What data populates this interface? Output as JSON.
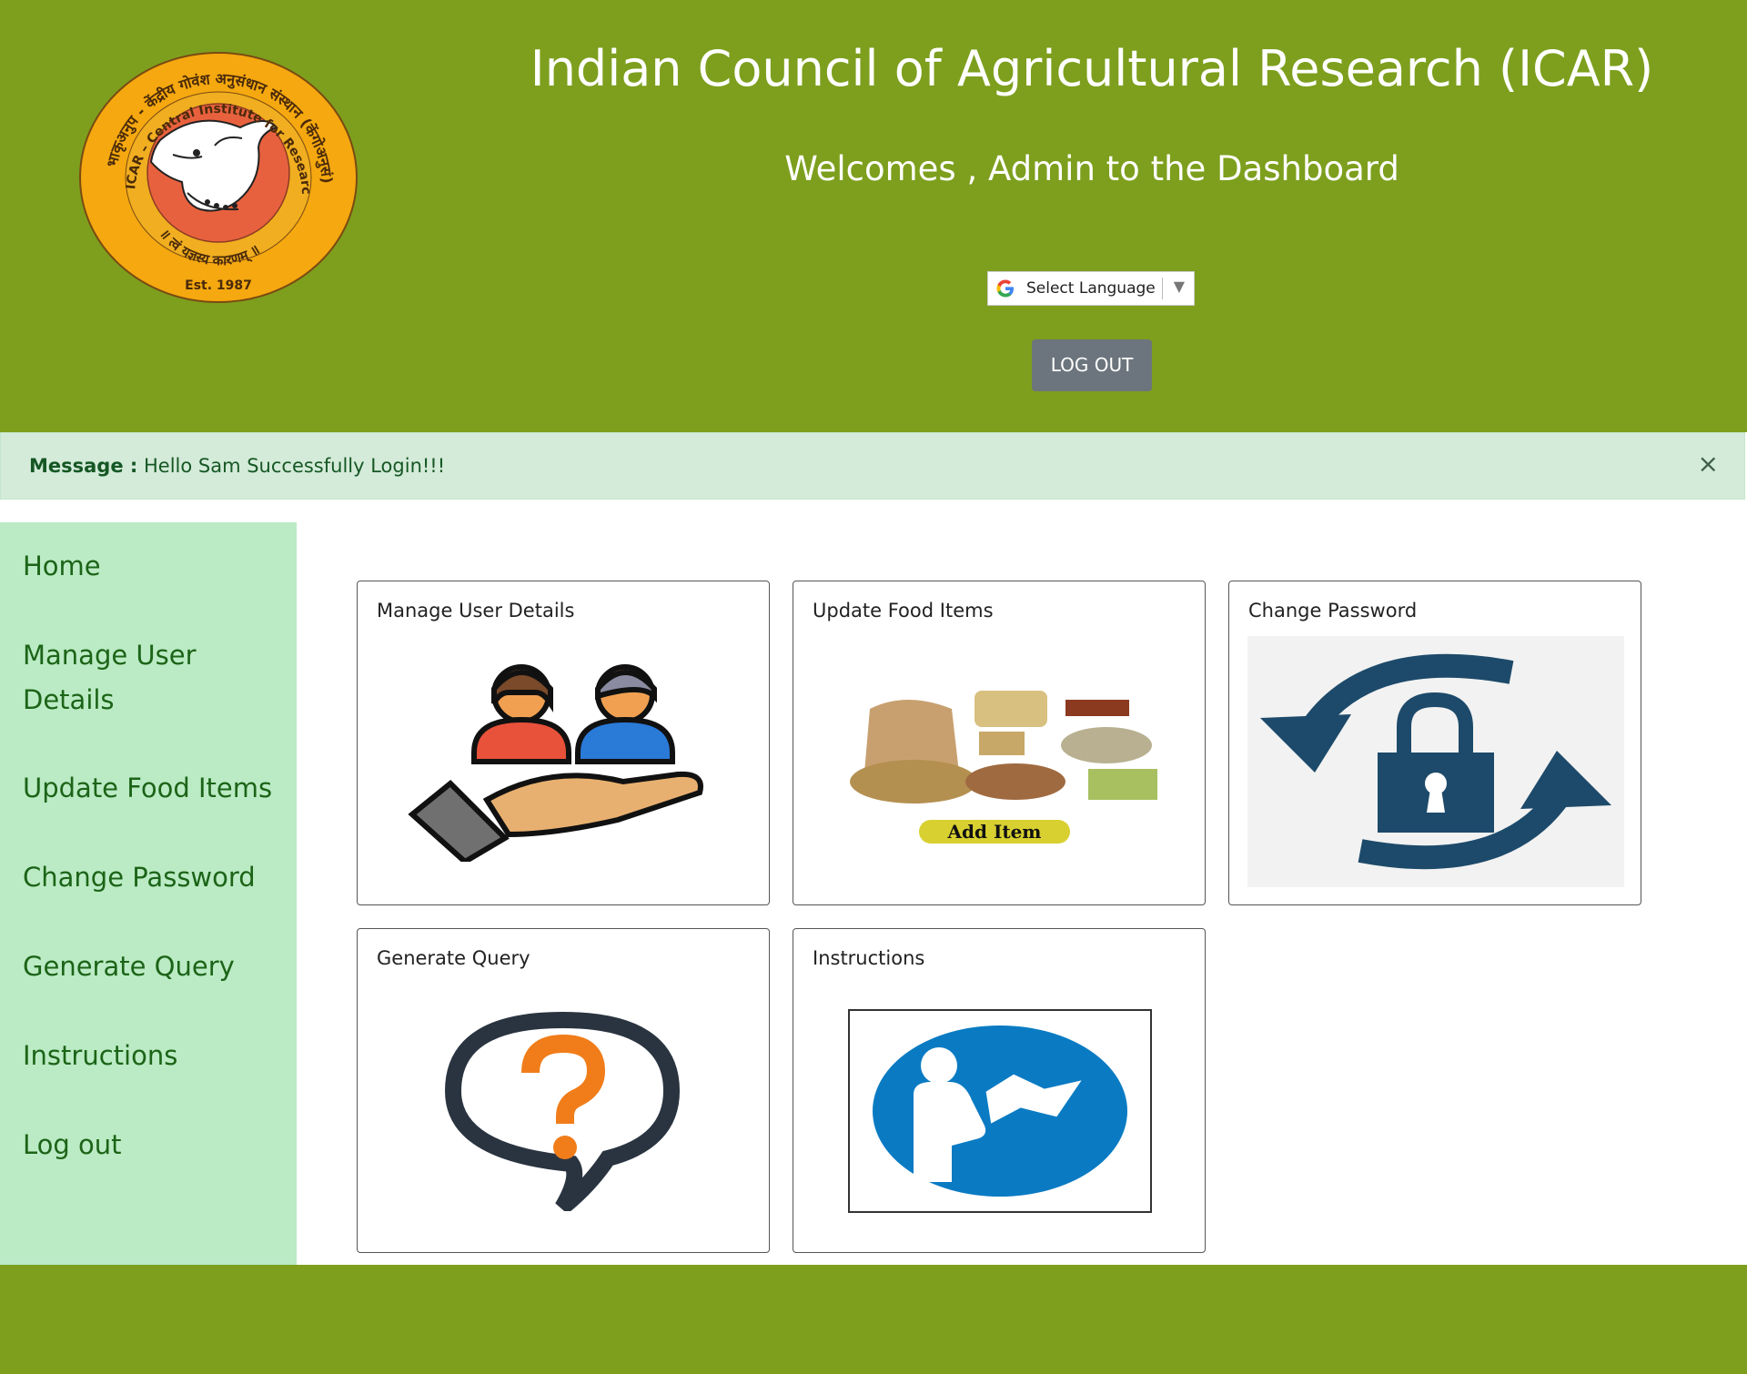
{
  "header": {
    "title": "Indian Council of Agricultural Research (ICAR)",
    "subtitle": "Welcomes , Admin to the Dashboard",
    "logo": {
      "top_arc_hindi": "भाकृअनुप - केंद्रीय गोवंश अनुसंधान संस्थान (केंगोअनुसं)",
      "inner_arc": "ICAR – Central Institute for Research on Cattle (CIRC)",
      "motto": "॥ त्वं यज्ञस्य कारणम् ॥",
      "established": "Est. 1987"
    },
    "language_select": {
      "label": "Select Language"
    },
    "logout_button": "LOG OUT"
  },
  "alert": {
    "prefix": "Message :",
    "text": "Hello Sam Successfully Login!!!",
    "close": "×"
  },
  "sidebar": {
    "items": [
      {
        "label": "Home"
      },
      {
        "label": "Manage User Details"
      },
      {
        "label": "Update Food Items"
      },
      {
        "label": "Change Password"
      },
      {
        "label": "Generate Query"
      },
      {
        "label": "Instructions"
      },
      {
        "label": "Log out"
      }
    ]
  },
  "cards": [
    {
      "title": "Manage User Details",
      "icon": "users-hand-icon"
    },
    {
      "title": "Update Food Items",
      "icon": "food-items-icon",
      "badge": "Add Item"
    },
    {
      "title": "Change Password",
      "icon": "lock-refresh-icon"
    },
    {
      "title": "Generate Query",
      "icon": "question-bubble-icon"
    },
    {
      "title": "Instructions",
      "icon": "reading-manual-icon"
    }
  ],
  "colors": {
    "header_bg": "#7d9f1d",
    "sidebar_bg": "#bbebc4",
    "sidebar_text": "#1c6418",
    "alert_bg": "#d4ebd9",
    "logout_bg": "#6c757d"
  }
}
